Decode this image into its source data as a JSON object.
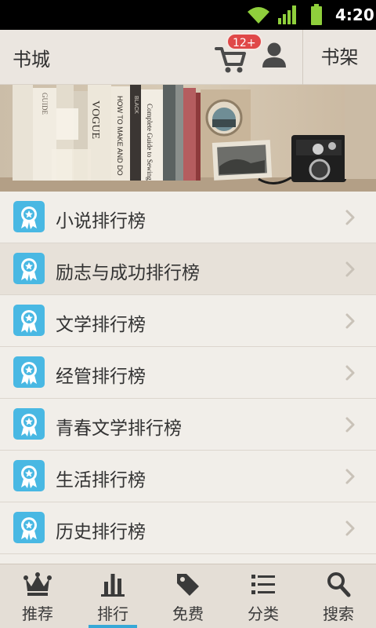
{
  "status_bar": {
    "time": "4:20",
    "icons": [
      "wifi-icon",
      "signal-icon",
      "battery-icon"
    ]
  },
  "header": {
    "title": "书城",
    "cart_badge": "12+",
    "shelf_label": "书架",
    "icons": [
      "cart-icon",
      "user-icon"
    ]
  },
  "banner": {
    "page_count": 5,
    "active_page": 3,
    "spine_texts": [
      "VOGUE",
      "HOW TO MAKE AND DO",
      "Complete Guide to Sewing",
      "GUIDE",
      "BLACK"
    ]
  },
  "rankings": {
    "items": [
      {
        "label": "小说排行榜",
        "highlighted": false
      },
      {
        "label": "励志与成功排行榜",
        "highlighted": true
      },
      {
        "label": "文学排行榜",
        "highlighted": false
      },
      {
        "label": "经管排行榜",
        "highlighted": false
      },
      {
        "label": "青春文学排行榜",
        "highlighted": false
      },
      {
        "label": "生活排行榜",
        "highlighted": false
      },
      {
        "label": "历史排行榜",
        "highlighted": false
      }
    ]
  },
  "bottom_nav": {
    "items": [
      {
        "label": "推荐",
        "icon": "crown-icon",
        "active": false
      },
      {
        "label": "排行",
        "icon": "bar-chart-icon",
        "active": true
      },
      {
        "label": "免费",
        "icon": "tag-icon",
        "active": false
      },
      {
        "label": "分类",
        "icon": "list-icon",
        "active": false
      },
      {
        "label": "搜索",
        "icon": "search-icon",
        "active": false
      }
    ]
  },
  "colors": {
    "accent": "#37a8d7",
    "badge": "#e04848",
    "background": "#f1eee9",
    "highlight_row": "#e7e1d9"
  }
}
